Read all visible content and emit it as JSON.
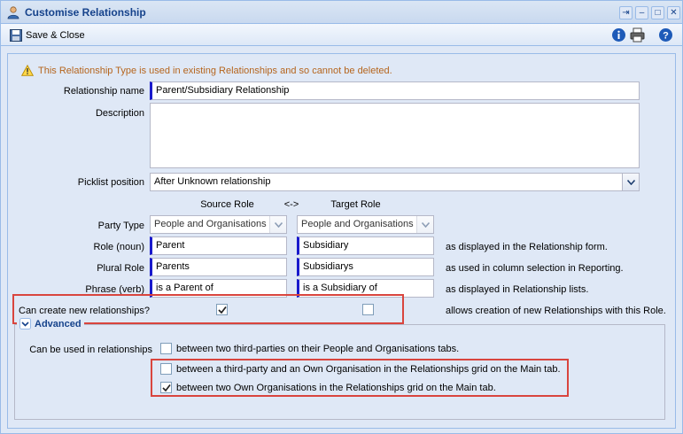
{
  "window": {
    "title": "Customise Relationship",
    "tools": [
      "pin-icon",
      "minimize-icon",
      "maximize-icon",
      "close-icon"
    ]
  },
  "toolbar": {
    "save_label": "Save & Close",
    "icons": [
      "info-icon",
      "print-icon",
      "help-icon"
    ]
  },
  "warning": "This Relationship Type is used in existing Relationships and so cannot be deleted.",
  "form": {
    "name_label": "Relationship name",
    "name_value": "Parent/Subsidiary Relationship",
    "description_label": "Description",
    "description_value": "",
    "picklist_label": "Picklist position",
    "picklist_value": "After Unknown relationship",
    "source_header": "Source Role",
    "arrow_header": "<->",
    "target_header": "Target Role",
    "party_type_label": "Party Type",
    "party_source": "People and Organisations",
    "party_target": "People and Organisations",
    "role_label": "Role (noun)",
    "role_source": "Parent",
    "role_target": "Subsidiary",
    "role_hint": "as displayed in the Relationship form.",
    "plural_label": "Plural Role",
    "plural_source": "Parents",
    "plural_target": "Subsidiarys",
    "plural_hint": "as used in column selection in Reporting.",
    "phrase_label": "Phrase (verb)",
    "phrase_source": "is a Parent of",
    "phrase_target": "is a Subsidiary of",
    "phrase_hint": "as displayed in Relationship lists.",
    "can_create_label": "Can create new relationships?",
    "can_create_source_checked": true,
    "can_create_target_checked": false,
    "can_create_hint": "allows creation of new Relationships with this Role."
  },
  "advanced": {
    "legend": "Advanced",
    "used_in_label": "Can be used in relationships",
    "options": [
      {
        "label": "between two third-parties on their People and Organisations tabs.",
        "checked": false
      },
      {
        "label": "between a third-party and an Own Organisation in the Relationships grid on the Main tab.",
        "checked": false
      },
      {
        "label": "between two Own Organisations in the Relationships grid on the Main tab.",
        "checked": true
      }
    ]
  },
  "colors": {
    "title_text": "#15428b",
    "required_marker": "#1a1acc",
    "highlight_box": "#d9453e",
    "warning_text": "#b5651d"
  }
}
